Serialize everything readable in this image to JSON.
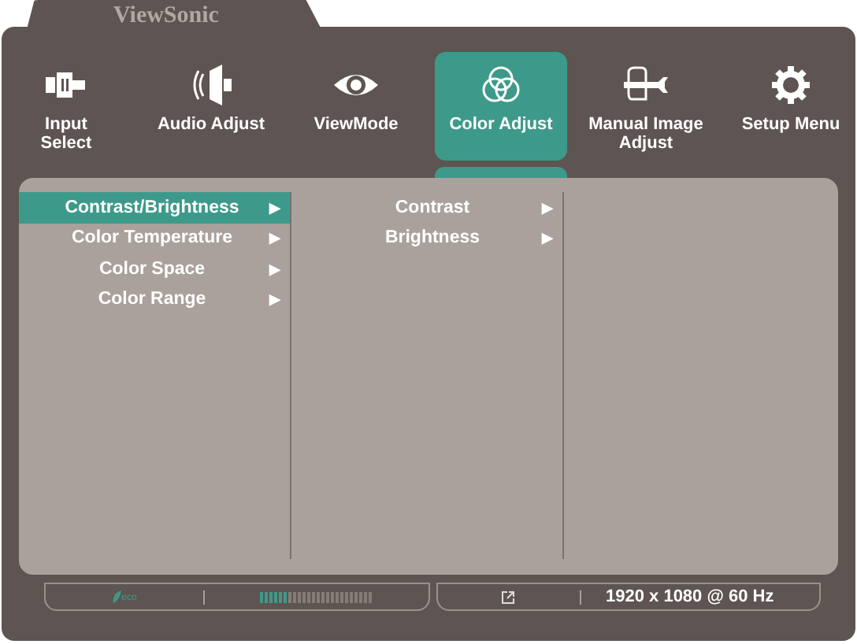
{
  "brand": "ViewSonic",
  "tabs": [
    {
      "kind": "input",
      "label": "Input\nSelect",
      "selected": false
    },
    {
      "kind": "audio",
      "label": "Audio Adjust",
      "selected": false
    },
    {
      "kind": "view",
      "label": "ViewMode",
      "selected": false
    },
    {
      "kind": "color",
      "label": "Color Adjust",
      "selected": true
    },
    {
      "kind": "manual",
      "label": "Manual Image\nAdjust",
      "selected": false
    },
    {
      "kind": "setup",
      "label": "Setup Menu",
      "selected": false
    }
  ],
  "menu": [
    {
      "label": "Contrast/Brightness",
      "arrow": "▶",
      "selected": true
    },
    {
      "label": "Color Temperature",
      "arrow": "▶",
      "selected": false
    },
    {
      "label": "Color Space",
      "arrow": "▶",
      "selected": false
    },
    {
      "label": "Color Range",
      "arrow": "▶",
      "selected": false
    }
  ],
  "submenu": [
    {
      "label": "Contrast",
      "arrow": "▶",
      "selected": false
    },
    {
      "label": "Brightness",
      "arrow": "▶",
      "selected": false
    }
  ],
  "status_bar": {
    "eco": "eco",
    "meter": {
      "level": 0.25
    },
    "resolution": "1920 x 1080 @ 60 Hz"
  }
}
